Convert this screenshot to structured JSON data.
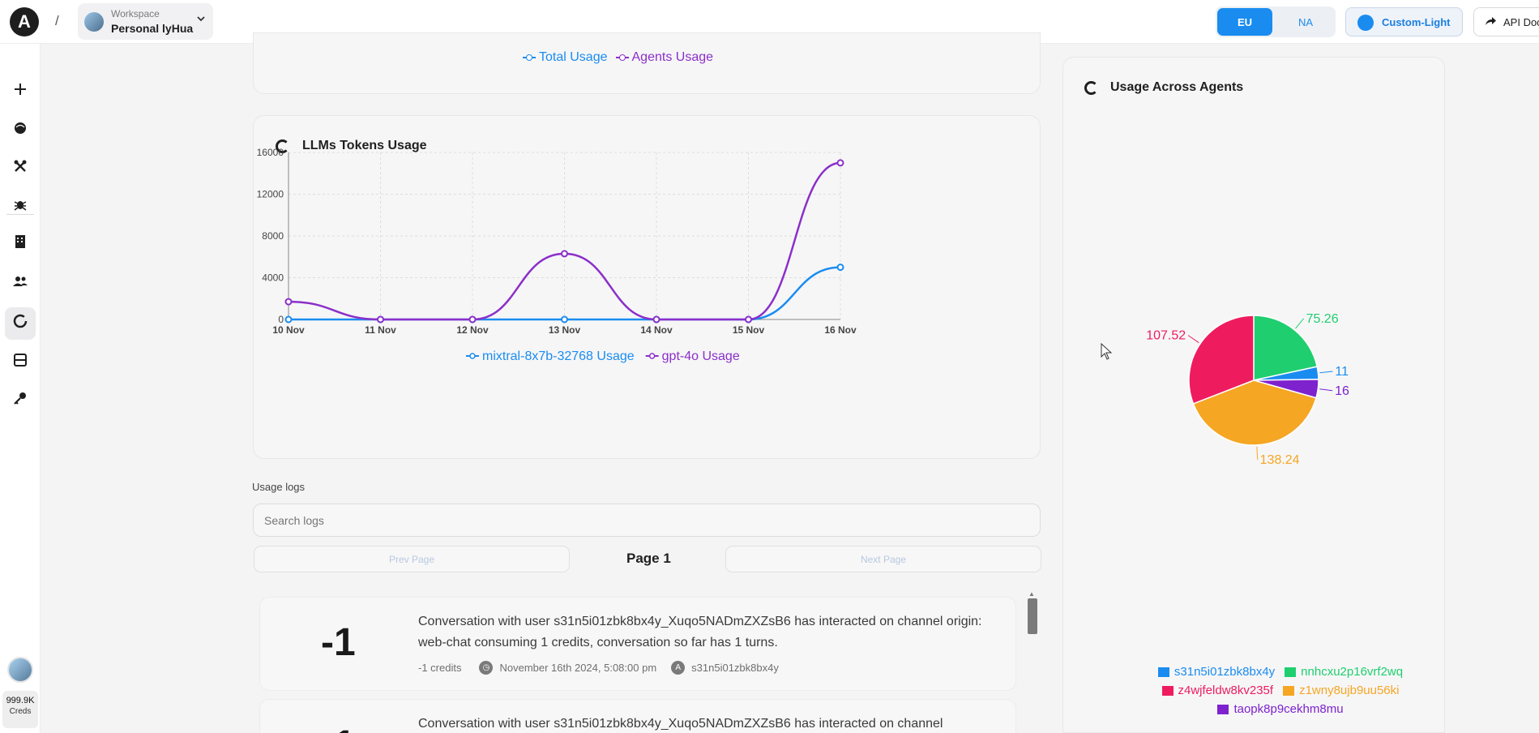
{
  "topbar": {
    "logo": "A",
    "separator": "/",
    "workspace_label": "Workspace",
    "workspace_name": "Personal lyHua",
    "region_eu": "EU",
    "region_na": "NA",
    "theme_label": "Custom-Light",
    "api_docs_label": "API Doc"
  },
  "sidebar": {
    "icons": [
      "plus-icon",
      "agent-icon",
      "tools-icon",
      "bug-icon",
      "building-icon",
      "users-icon",
      "usage-icon",
      "layout-icon",
      "key-icon"
    ],
    "credits_value": "999.9K",
    "credits_label": "Creds"
  },
  "usage_card_top": {
    "legend": [
      {
        "name": "Total Usage",
        "color": "#1a8cf0"
      },
      {
        "name": "Agents Usage",
        "color": "#8b2fc9"
      }
    ]
  },
  "llm_card": {
    "title": "LLMs Tokens Usage"
  },
  "agents_card": {
    "title": "Usage Across Agents"
  },
  "logs": {
    "section_label": "Usage logs",
    "search_placeholder": "Search logs",
    "prev_label": "Prev Page",
    "next_label": "Next Page",
    "page_label": "Page 1",
    "entries": [
      {
        "amount": "-1",
        "text": "Conversation with user s31n5i01zbk8bx4y_Xuqo5NADmZXZsB6 has interacted on channel origin: web-chat consuming 1 credits, conversation so far has 1 turns.",
        "credits": "-1 credits",
        "date": "November 16th 2024, 5:08:00 pm",
        "agent": "s31n5i01zbk8bx4y"
      },
      {
        "amount": "-1",
        "text": "Conversation with user s31n5i01zbk8bx4y_Xuqo5NADmZXZsB6 has interacted on channel",
        "credits": "",
        "date": "",
        "agent": ""
      }
    ]
  },
  "chart_data": [
    {
      "type": "line",
      "x": [
        "10 Nov",
        "11 Nov",
        "12 Nov",
        "13 Nov",
        "14 Nov",
        "15 Nov",
        "16 Nov"
      ],
      "ylim": [
        0,
        16000
      ],
      "yticks": [
        0,
        4000,
        8000,
        12000,
        16000
      ],
      "grid": true,
      "legend_position": "bottom",
      "series": [
        {
          "name": "mixtral-8x7b-32768 Usage",
          "color": "#1a8cf0",
          "values": [
            0,
            0,
            0,
            0,
            0,
            0,
            5000
          ]
        },
        {
          "name": "gpt-4o Usage",
          "color": "#8b2fc9",
          "values": [
            1700,
            0,
            0,
            6300,
            0,
            0,
            15000
          ]
        }
      ]
    },
    {
      "type": "pie",
      "legend_position": "bottom",
      "slices": [
        {
          "name": "s31n5i01zbk8bx4y",
          "value": 11,
          "label": "11",
          "color": "#1a8cf0"
        },
        {
          "name": "taopk8p9cekhm8mu",
          "value": 16,
          "label": "16",
          "color": "#7e22ce"
        },
        {
          "name": "z1wny8ujb9uu56ki",
          "value": 138.24,
          "label": "138.24",
          "color": "#f5a623"
        },
        {
          "name": "z4wjfeldw8kv235f",
          "value": 107.52,
          "label": "107.52",
          "color": "#ee1c5f"
        },
        {
          "name": "nnhcxu2p16vrf2wq",
          "value": 75.26,
          "label": "75.26",
          "color": "#1fcf6f"
        }
      ]
    }
  ]
}
